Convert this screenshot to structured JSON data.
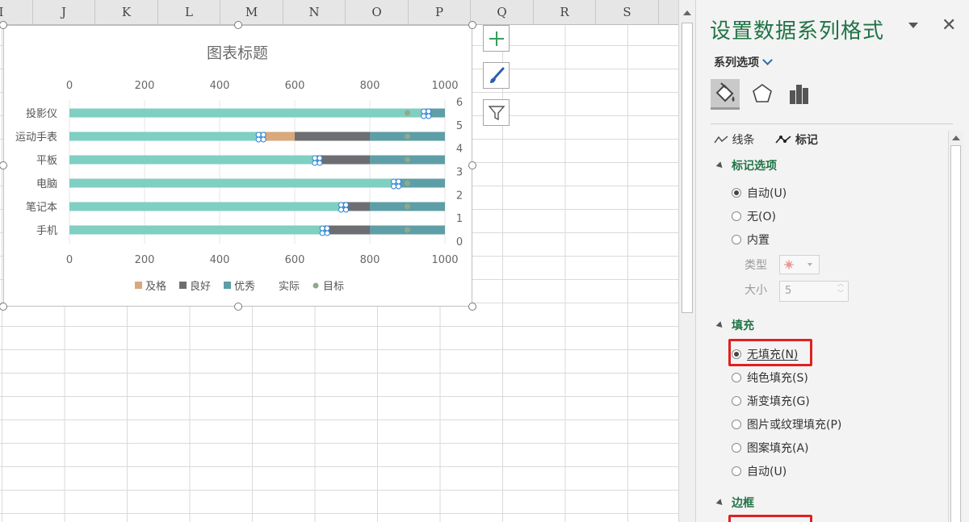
{
  "sheet": {
    "columns": [
      "I",
      "J",
      "K",
      "L",
      "M",
      "N",
      "O",
      "P",
      "Q",
      "R",
      "S"
    ]
  },
  "chart_data": {
    "type": "bar",
    "orientation": "horizontal",
    "stacked": true,
    "title": "图表标题",
    "categories": [
      "手机",
      "笔记本",
      "电脑",
      "平板",
      "运动手表",
      "投影仪"
    ],
    "series": [
      {
        "name": "及格",
        "color": "#d9a87c",
        "values": [
          0,
          0,
          0,
          0,
          600,
          0
        ]
      },
      {
        "name": "良好",
        "color": "#6d6e72",
        "values": [
          800,
          800,
          800,
          800,
          800,
          800
        ]
      },
      {
        "name": "优秀",
        "color": "#5e9ea7",
        "values": [
          1000,
          1000,
          1000,
          1000,
          1000,
          1000
        ]
      },
      {
        "name": "实际",
        "color": "#7fcfc2",
        "values": [
          680,
          730,
          870,
          660,
          510,
          950
        ]
      },
      {
        "name": "目标",
        "color": "#8fa98c",
        "type": "scatter",
        "values": [
          900,
          900,
          900,
          900,
          900,
          900
        ]
      }
    ],
    "x_axis_top": {
      "ticks": [
        "0",
        "200",
        "400",
        "600",
        "800",
        "1000"
      ],
      "range": [
        0,
        1000
      ]
    },
    "x_axis_bottom": {
      "ticks": [
        "0",
        "200",
        "400",
        "600",
        "800",
        "1000"
      ],
      "range": [
        0,
        1000
      ]
    },
    "y_axis_secondary": {
      "ticks": [
        "0",
        "1",
        "2",
        "3",
        "4",
        "5",
        "6"
      ],
      "range": [
        0,
        6
      ]
    },
    "legend": {
      "position": "bottom",
      "entries": [
        "及格",
        "良好",
        "优秀",
        "实际",
        "目标"
      ]
    },
    "grid": true
  },
  "chart_tools": {
    "add_element": "plus-icon",
    "styles": "brush-icon",
    "filter": "filter-icon"
  },
  "pane": {
    "title": "设置数据系列格式",
    "series_options_label": "系列选项",
    "subtabs": {
      "line": "线条",
      "marker": "标记"
    },
    "marker_options": {
      "header": "标记选项",
      "options": [
        "自动(U)",
        "无(O)",
        "内置"
      ],
      "type_label": "类型",
      "size_label": "大小",
      "size_value": "5"
    },
    "fill": {
      "header": "填充",
      "options": [
        "无填充(N)",
        "纯色填充(S)",
        "渐变填充(G)",
        "图片或纹理填充(P)",
        "图案填充(A)",
        "自动(U)"
      ]
    },
    "border": {
      "header": "边框"
    },
    "accent": "#217346",
    "highlight": "#e02020"
  }
}
